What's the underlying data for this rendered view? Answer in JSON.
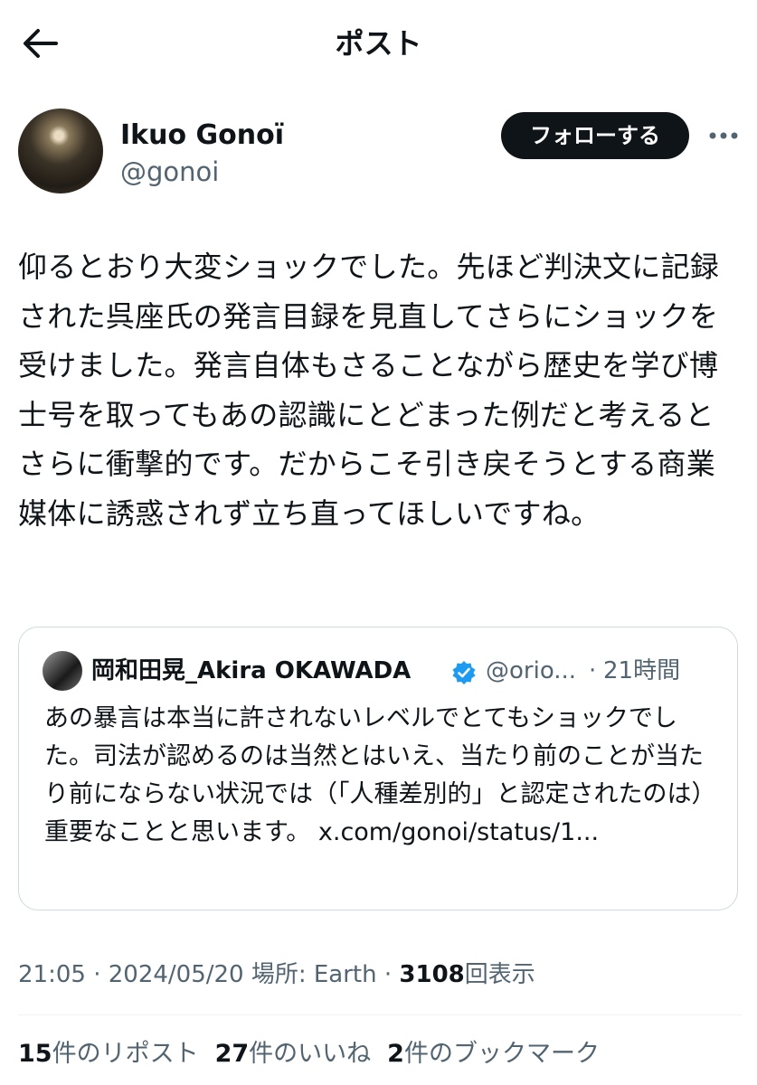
{
  "header": {
    "title": "ポスト",
    "back_icon": "arrow-left-icon"
  },
  "author": {
    "display_name": "Ikuo Gonoï",
    "handle": "@gonoi",
    "follow_label": "フォローする",
    "more_icon": "more-icon"
  },
  "post": {
    "text": "仰るとおり大変ショックでした。先ほど判決文に記録された呉座氏の発言目録を見直してさらにショックを受けました。発言自体もさることながら歴史を学び博士号を取ってもあの認識にとどまった例だと考えるとさらに衝撃的です。だからこそ引き戻そうとする商業媒体に誘惑されず立ち直ってほしいですね。"
  },
  "quote": {
    "display_name": "岡和田晃_Akira OKAWADA",
    "verified_icon": "verified-badge-icon",
    "handle": "@orio...",
    "separator": "·",
    "time": "21時間",
    "text": "あの暴言は本当に許されないレベルでとてもショックでした。司法が認めるのは当然とはいえ、当たり前のことが当たり前にならない状況では（「人種差別的」と認定されたのは）重要なことと思います。 x.com/gonoi/status/1..."
  },
  "meta": {
    "time": "21:05",
    "date": "2024/05/20",
    "location_label": "場所: Earth",
    "views": "3108",
    "views_label": "回表示"
  },
  "stats": {
    "reposts": "15",
    "reposts_label": "件のリポスト",
    "likes": "27",
    "likes_label": "件のいいね",
    "bookmarks": "2",
    "bookmarks_label": "件のブックマーク"
  },
  "colors": {
    "text": "#0f1419",
    "secondary": "#536471",
    "verified": "#1d9bf0",
    "border": "#cfd9de"
  }
}
